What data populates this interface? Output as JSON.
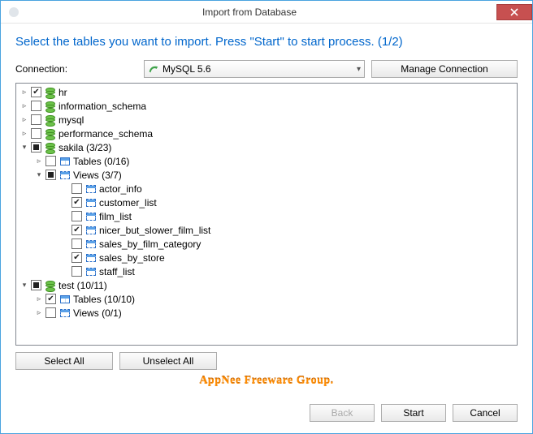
{
  "window": {
    "title": "Import from Database"
  },
  "instruction": "Select the tables you want to import. Press \"Start\" to start process. (1/2)",
  "connection": {
    "label": "Connection:",
    "selected": "MySQL 5.6",
    "manage_label": "Manage Connection"
  },
  "tree": [
    {
      "id": "hr",
      "label": "hr",
      "icon": "database",
      "check": "checked",
      "expandable": true,
      "expanded": false,
      "depth": 1
    },
    {
      "id": "information_schema",
      "label": "information_schema",
      "icon": "database",
      "check": "unchecked",
      "expandable": true,
      "expanded": false,
      "depth": 1
    },
    {
      "id": "mysql",
      "label": "mysql",
      "icon": "database",
      "check": "unchecked",
      "expandable": true,
      "expanded": false,
      "depth": 1
    },
    {
      "id": "performance_schema",
      "label": "performance_schema",
      "icon": "database",
      "check": "unchecked",
      "expandable": true,
      "expanded": false,
      "depth": 1
    },
    {
      "id": "sakila",
      "label": "sakila (3/23)",
      "icon": "database",
      "check": "indeterminate",
      "expandable": true,
      "expanded": true,
      "depth": 1
    },
    {
      "id": "sakila_tables",
      "label": "Tables (0/16)",
      "icon": "table",
      "check": "unchecked",
      "expandable": true,
      "expanded": false,
      "depth": 2
    },
    {
      "id": "sakila_views",
      "label": "Views (3/7)",
      "icon": "view",
      "check": "indeterminate",
      "expandable": true,
      "expanded": true,
      "depth": 2
    },
    {
      "id": "actor_info",
      "label": "actor_info",
      "icon": "view",
      "check": "unchecked",
      "expandable": false,
      "depth": 3
    },
    {
      "id": "customer_list",
      "label": "customer_list",
      "icon": "view",
      "check": "checked",
      "expandable": false,
      "depth": 3
    },
    {
      "id": "film_list",
      "label": "film_list",
      "icon": "view",
      "check": "unchecked",
      "expandable": false,
      "depth": 3
    },
    {
      "id": "nicer_but_slower_film_list",
      "label": "nicer_but_slower_film_list",
      "icon": "view",
      "check": "checked",
      "expandable": false,
      "depth": 3
    },
    {
      "id": "sales_by_film_category",
      "label": "sales_by_film_category",
      "icon": "view",
      "check": "unchecked",
      "expandable": false,
      "depth": 3
    },
    {
      "id": "sales_by_store",
      "label": "sales_by_store",
      "icon": "view",
      "check": "checked",
      "expandable": false,
      "depth": 3
    },
    {
      "id": "staff_list",
      "label": "staff_list",
      "icon": "view",
      "check": "unchecked",
      "expandable": false,
      "depth": 3
    },
    {
      "id": "test",
      "label": "test (10/11)",
      "icon": "database",
      "check": "indeterminate",
      "expandable": true,
      "expanded": true,
      "depth": 1
    },
    {
      "id": "test_tables",
      "label": "Tables (10/10)",
      "icon": "table",
      "check": "checked",
      "expandable": true,
      "expanded": false,
      "depth": 2
    },
    {
      "id": "test_views",
      "label": "Views (0/1)",
      "icon": "view",
      "check": "unchecked",
      "expandable": true,
      "expanded": false,
      "depth": 2
    }
  ],
  "buttons": {
    "select_all": "Select All",
    "unselect_all": "Unselect All",
    "back": "Back",
    "start": "Start",
    "cancel": "Cancel"
  },
  "watermark": "AppNee Freeware Group.",
  "footer_disabled": {
    "back": true
  }
}
